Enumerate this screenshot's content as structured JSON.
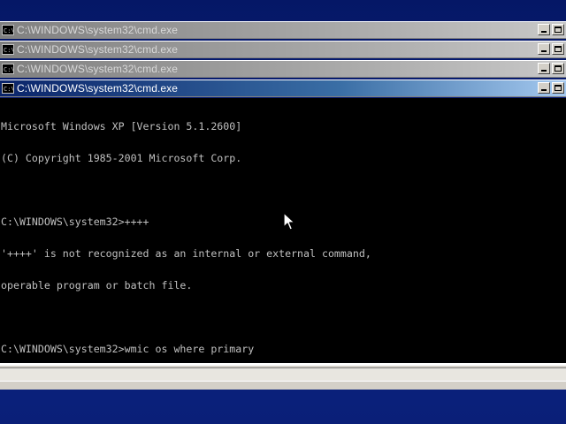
{
  "windows": [
    {
      "title": "C:\\WINDOWS\\system32\\cmd.exe",
      "state": "inactive"
    },
    {
      "title": "C:\\WINDOWS\\system32\\cmd.exe",
      "state": "inactive"
    },
    {
      "title": "C:\\WINDOWS\\system32\\cmd.exe",
      "state": "inactive"
    },
    {
      "title": "C:\\WINDOWS\\system32\\cmd.exe",
      "state": "active"
    }
  ],
  "console": {
    "lines": [
      "Microsoft Windows XP [Version 5.1.2600]",
      "(C) Copyright 1985-2001 Microsoft Corp.",
      "",
      "C:\\WINDOWS\\system32>++++",
      "'++++' is not recognized as an internal or external command,",
      "operable program or batch file.",
      "",
      "C:\\WINDOWS\\system32>wmic os where primary"
    ]
  },
  "icons": {
    "window_icon": "cmd-icon",
    "minimize": "minimize-icon",
    "maximize": "maximize-icon",
    "pointer": "mouse-pointer-icon"
  },
  "colors": {
    "console_bg": "#000000",
    "console_fg": "#c0c0c0",
    "active_title": "#0a246a",
    "inactive_title": "#808080",
    "desktop": "#0a1c6e"
  }
}
